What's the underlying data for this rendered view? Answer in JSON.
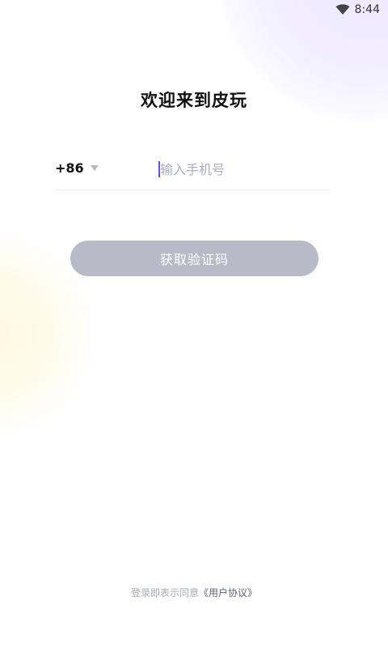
{
  "status_bar": {
    "time": "8:44",
    "icon": "wifi-icon"
  },
  "title": "欢迎来到皮玩",
  "phone": {
    "country_code": "+86",
    "dropdown_icon": "caret-down-icon",
    "placeholder": "输入手机号",
    "value": ""
  },
  "actions": {
    "get_code_label": "获取验证码"
  },
  "agreement": {
    "prefix": "登录即表示同意",
    "link": "《用户协议》"
  },
  "colors": {
    "accent": "#6a4cff",
    "button_disabled": "#b8bac8",
    "placeholder": "#a9acbd",
    "muted_text": "#a6a8b7"
  }
}
